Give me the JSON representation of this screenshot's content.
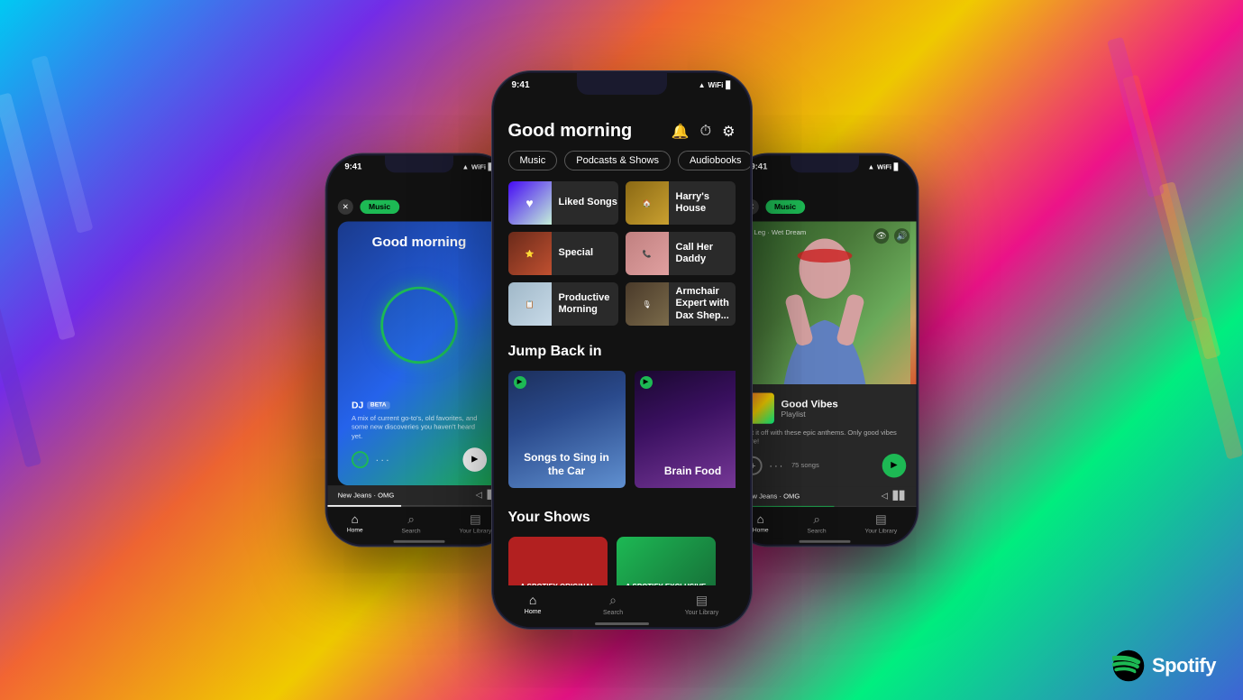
{
  "background": {
    "colors": [
      "#00d4ff",
      "#7b2ff7",
      "#ff6b35",
      "#ffd700",
      "#ff1493",
      "#00ff88",
      "#4169e1"
    ]
  },
  "phones": {
    "left": {
      "status": {
        "time": "9:41",
        "right": "●●● ▲ ■"
      },
      "filter_pill": "Music",
      "card": {
        "title": "Good morning",
        "dj_label": "DJ",
        "beta_label": "BETA",
        "description": "A mix of current go-to's, old favorites, and some new discoveries you haven't heard yet."
      },
      "now_playing": "New Jeans · OMG",
      "nav": {
        "home": "Home",
        "search": "Search",
        "library": "Your Library"
      }
    },
    "center": {
      "status": {
        "time": "9:41"
      },
      "header": {
        "title": "Good morning",
        "icons": [
          "bell",
          "timer",
          "gear"
        ]
      },
      "filter_tabs": [
        {
          "label": "Music",
          "active": false
        },
        {
          "label": "Podcasts & Shows",
          "active": false
        },
        {
          "label": "Audiobooks",
          "active": false
        }
      ],
      "quick_items": [
        {
          "label": "Liked Songs",
          "type": "liked"
        },
        {
          "label": "Harry's House",
          "type": "harrys"
        },
        {
          "label": "Special",
          "type": "special"
        },
        {
          "label": "Call Her Daddy",
          "type": "call-her"
        },
        {
          "label": "Productive Morning",
          "type": "productive"
        },
        {
          "label": "Armchair Expert with Dax Shep...",
          "type": "armchair"
        }
      ],
      "sections": {
        "jump_back_in": {
          "title": "Jump Back in",
          "playlists": [
            {
              "label": "Songs to Sing in the Car",
              "type": "songs-car"
            },
            {
              "label": "Brain Food",
              "type": "brain-food"
            }
          ]
        },
        "your_shows": {
          "title": "Your Shows",
          "shows": [
            {
              "label": "A Spotify Original",
              "type": "show1"
            },
            {
              "label": "A Spotify Exclusive",
              "type": "show2"
            }
          ]
        }
      },
      "nav": {
        "home": "Home",
        "search": "Search",
        "library": "Your Library"
      }
    },
    "right": {
      "status": {
        "time": "9:41"
      },
      "filter_pill": "Music",
      "album": {
        "label": "Wet Leg · Wet Dream"
      },
      "playlist": {
        "name": "Good Vibes",
        "type": "Playlist",
        "description": "Set it off with these epic anthems. Only good vibes here!",
        "songs_count": "75 songs"
      },
      "now_playing": "New Jeans · OMG",
      "nav": {
        "home": "Home",
        "search": "Search",
        "library": "Your Library"
      }
    }
  },
  "spotify": {
    "name": "Spotify"
  }
}
